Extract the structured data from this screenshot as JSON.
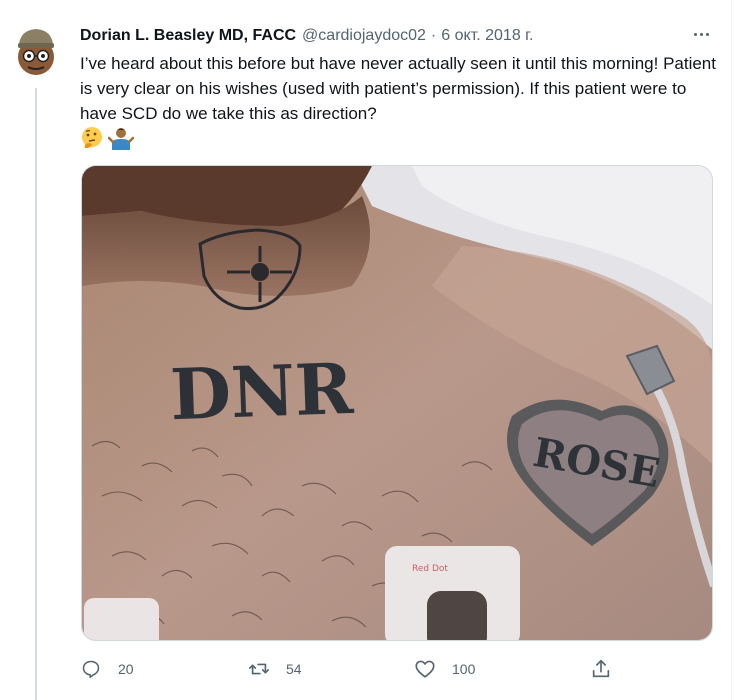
{
  "tweet": {
    "author_name": "Dorian L. Beasley MD, FACC",
    "handle": "@cardiojaydoc02",
    "separator": "·",
    "date": "6 окт. 2018 г.",
    "text": "I’ve heard about this before but have never actually seen it until this morning! Patient is very clear on his wishes (used with patient’s permission). If this patient were to have SCD do we take this as direction?",
    "emojis": [
      "thinking-face-emoji",
      "person-shrugging-emoji"
    ]
  },
  "photo": {
    "tattoo_main": "DNR",
    "tattoo_heart": "ROSE",
    "electrode_text": "Red Dot"
  },
  "actions": {
    "reply_count": "20",
    "retweet_count": "54",
    "like_count": "100"
  },
  "colors": {
    "text_primary": "#0f1419",
    "text_secondary": "#536471",
    "thread_line": "#cfd9de"
  },
  "icons": [
    "avatar-emoji",
    "more-icon",
    "reply-icon",
    "retweet-icon",
    "like-icon",
    "share-icon"
  ]
}
